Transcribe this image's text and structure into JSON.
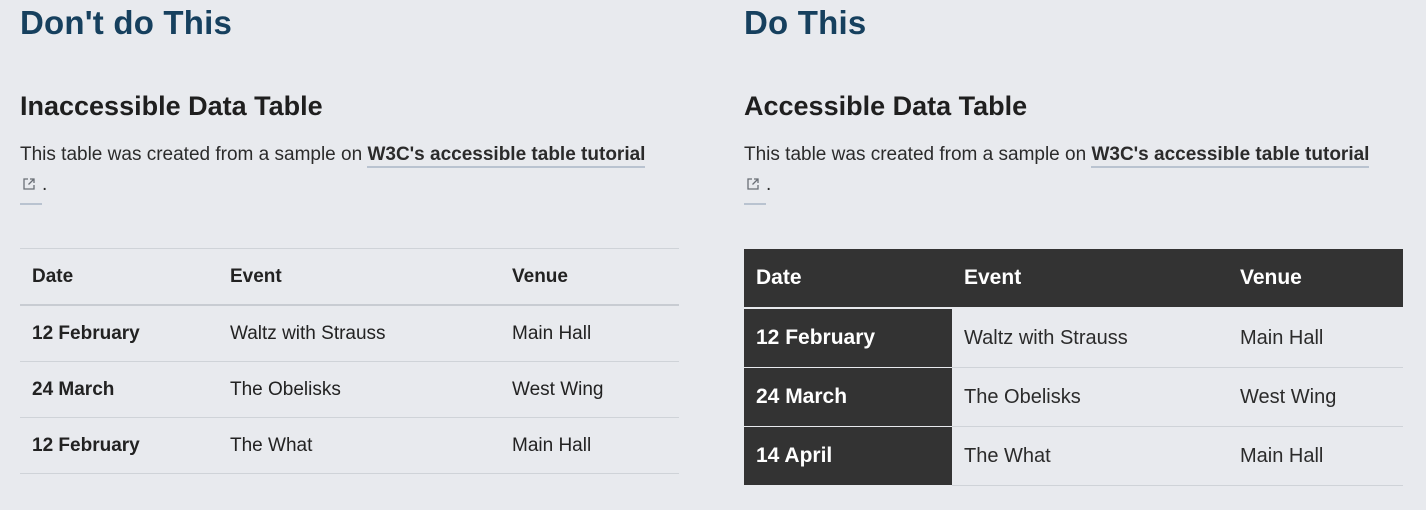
{
  "left": {
    "heading": "Don't do This",
    "subheading": "Inaccessible Data Table",
    "paragraph_prefix": "This table was created from a sample on ",
    "link_text": "W3C's accessible table tutorial",
    "paragraph_suffix": ".",
    "table": {
      "headers": [
        "Date",
        "Event",
        "Venue"
      ],
      "rows": [
        [
          "12 February",
          "Waltz with Strauss",
          "Main Hall"
        ],
        [
          "24 March",
          "The Obelisks",
          "West Wing"
        ],
        [
          "12 February",
          "The What",
          "Main Hall"
        ]
      ]
    }
  },
  "right": {
    "heading": "Do This",
    "subheading": "Accessible Data Table",
    "paragraph_prefix": "This table was created from a sample on ",
    "link_text": "W3C's accessible table tutorial",
    "paragraph_suffix": ".",
    "table": {
      "headers": [
        "Date",
        "Event",
        "Venue"
      ],
      "rows": [
        [
          "12 February",
          "Waltz with Strauss",
          "Main Hall"
        ],
        [
          "24 March",
          "The Obelisks",
          "West Wing"
        ],
        [
          "14 April",
          "The What",
          "Main Hall"
        ]
      ]
    }
  },
  "icons": {
    "external_link": "external-link-icon"
  },
  "colors": {
    "heading": "#16405e",
    "table_header_bg": "#333333",
    "page_bg": "#e8eaee"
  }
}
